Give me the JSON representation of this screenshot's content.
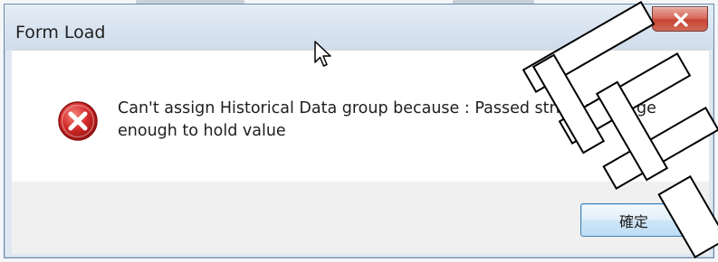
{
  "dialog": {
    "title": "Form Load",
    "message_line1": "Can't assign Historical Data group because : Passed string not large",
    "message_line2": "enough to hold value",
    "ok_label": "確定",
    "icon": "error-icon"
  },
  "close_button": {
    "icon": "close-icon"
  },
  "colors": {
    "error_red": "#d42b2b",
    "close_button_red": "#c74535",
    "title_bg": "#dfe8f2",
    "ok_border": "#3c7fb1"
  },
  "watermark": {
    "text": "黑"
  }
}
